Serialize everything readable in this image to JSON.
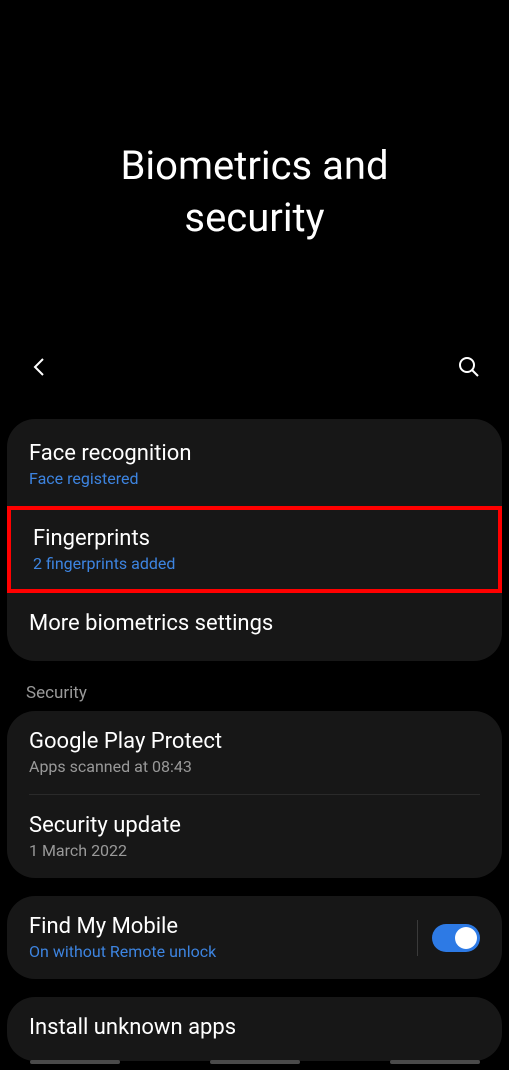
{
  "header": {
    "title_line1": "Biometrics and",
    "title_line2": "security"
  },
  "groups": [
    {
      "items": [
        {
          "id": "face-recognition",
          "title": "Face recognition",
          "subtitle": "Face registered",
          "subtitle_style": "blue"
        },
        {
          "id": "fingerprints",
          "title": "Fingerprints",
          "subtitle": "2 fingerprints added",
          "subtitle_style": "blue",
          "highlighted": true
        },
        {
          "id": "more-biometrics",
          "title": "More biometrics settings"
        }
      ]
    }
  ],
  "section_security_label": "Security",
  "security_group": {
    "items": [
      {
        "id": "google-play-protect",
        "title": "Google Play Protect",
        "subtitle": "Apps scanned at 08:43",
        "subtitle_style": "gray"
      },
      {
        "id": "security-update",
        "title": "Security update",
        "subtitle": "1 March 2022",
        "subtitle_style": "gray"
      }
    ]
  },
  "find_my_mobile": {
    "title": "Find My Mobile",
    "subtitle": "On without Remote unlock",
    "toggle_on": true
  },
  "install_unknown": {
    "title": "Install unknown apps"
  }
}
